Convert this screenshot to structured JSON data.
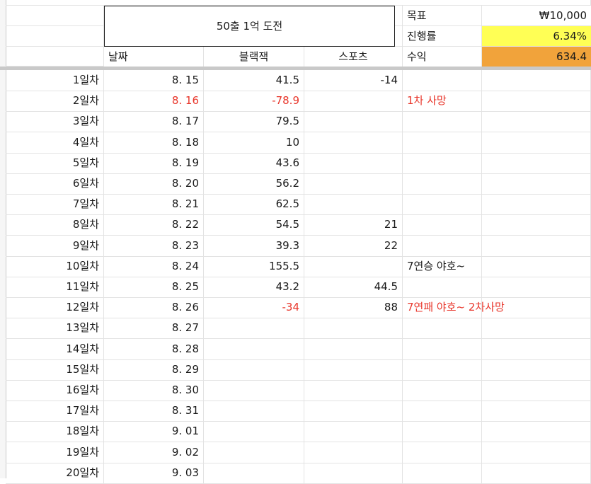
{
  "header": {
    "title": "50출 1억 도전",
    "columns": [
      "날짜",
      "블랙잭",
      "스포츠"
    ],
    "summary": [
      {
        "label": "목표",
        "value": "₩10,000",
        "bg": "#ffffff"
      },
      {
        "label": "진행률",
        "value": "6.34%",
        "bg": "#ffff55"
      },
      {
        "label": "수익",
        "value": "634.4",
        "bg": "#f1a33b"
      }
    ]
  },
  "rows": [
    {
      "day": "1일차",
      "date": "8. 15",
      "bj": "41.5",
      "sp": "-14",
      "note": "",
      "date_red": false,
      "bj_red": false,
      "note_red": false
    },
    {
      "day": "2일차",
      "date": "8. 16",
      "bj": "-78.9",
      "sp": "",
      "note": "1차  사망",
      "date_red": true,
      "bj_red": true,
      "note_red": true
    },
    {
      "day": "3일차",
      "date": "8. 17",
      "bj": "79.5",
      "sp": "",
      "note": "",
      "date_red": false,
      "bj_red": false,
      "note_red": false
    },
    {
      "day": "4일차",
      "date": "8. 18",
      "bj": "10",
      "sp": "",
      "note": "",
      "date_red": false,
      "bj_red": false,
      "note_red": false
    },
    {
      "day": "5일차",
      "date": "8. 19",
      "bj": "43.6",
      "sp": "",
      "note": "",
      "date_red": false,
      "bj_red": false,
      "note_red": false
    },
    {
      "day": "6일차",
      "date": "8. 20",
      "bj": "56.2",
      "sp": "",
      "note": "",
      "date_red": false,
      "bj_red": false,
      "note_red": false
    },
    {
      "day": "7일차",
      "date": "8. 21",
      "bj": "62.5",
      "sp": "",
      "note": "",
      "date_red": false,
      "bj_red": false,
      "note_red": false
    },
    {
      "day": "8일차",
      "date": "8. 22",
      "bj": "54.5",
      "sp": "21",
      "note": "",
      "date_red": false,
      "bj_red": false,
      "note_red": false
    },
    {
      "day": "9일차",
      "date": "8. 23",
      "bj": "39.3",
      "sp": "22",
      "note": "",
      "date_red": false,
      "bj_red": false,
      "note_red": false
    },
    {
      "day": "10일차",
      "date": "8. 24",
      "bj": "155.5",
      "sp": "",
      "note": "7연승 야호~",
      "date_red": false,
      "bj_red": false,
      "note_red": false
    },
    {
      "day": "11일차",
      "date": "8. 25",
      "bj": "43.2",
      "sp": "44.5",
      "note": "",
      "date_red": false,
      "bj_red": false,
      "note_red": false
    },
    {
      "day": "12일차",
      "date": "8. 26",
      "bj": "-34",
      "sp": "88",
      "note": "7연패 야호~ 2차사망",
      "date_red": false,
      "bj_red": true,
      "note_red": true
    },
    {
      "day": "13일차",
      "date": "8. 27",
      "bj": "",
      "sp": "",
      "note": "",
      "date_red": false,
      "bj_red": false,
      "note_red": false
    },
    {
      "day": "14일차",
      "date": "8. 28",
      "bj": "",
      "sp": "",
      "note": "",
      "date_red": false,
      "bj_red": false,
      "note_red": false
    },
    {
      "day": "15일차",
      "date": "8. 29",
      "bj": "",
      "sp": "",
      "note": "",
      "date_red": false,
      "bj_red": false,
      "note_red": false
    },
    {
      "day": "16일차",
      "date": "8. 30",
      "bj": "",
      "sp": "",
      "note": "",
      "date_red": false,
      "bj_red": false,
      "note_red": false
    },
    {
      "day": "17일차",
      "date": "8. 31",
      "bj": "",
      "sp": "",
      "note": "",
      "date_red": false,
      "bj_red": false,
      "note_red": false
    },
    {
      "day": "18일차",
      "date": "9. 01",
      "bj": "",
      "sp": "",
      "note": "",
      "date_red": false,
      "bj_red": false,
      "note_red": false
    },
    {
      "day": "19일차",
      "date": "9. 02",
      "bj": "",
      "sp": "",
      "note": "",
      "date_red": false,
      "bj_red": false,
      "note_red": false
    },
    {
      "day": "20일차",
      "date": "9. 03",
      "bj": "",
      "sp": "",
      "note": "",
      "date_red": false,
      "bj_red": false,
      "note_red": false
    }
  ]
}
